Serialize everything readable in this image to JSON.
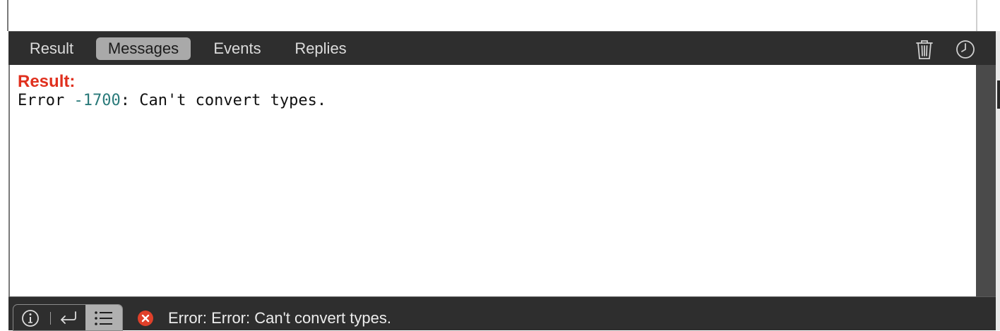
{
  "tabs": {
    "result": "Result",
    "messages": "Messages",
    "events": "Events",
    "replies": "Replies",
    "selected": "Messages"
  },
  "toolbar_icons": [
    "trash-icon",
    "clock-icon"
  ],
  "content": {
    "label": "Result:",
    "error_prefix": "Error ",
    "error_code": "-1700",
    "error_message": ": Can't convert types."
  },
  "status": {
    "buttons": [
      "info-icon",
      "return-icon",
      "list-icon"
    ],
    "selected_button": "list-icon",
    "error_icon": "error-icon",
    "message": "Error: Error: Can't convert types."
  },
  "colors": {
    "result_label": "#e0301e",
    "error_code": "#2a7a7a",
    "error_icon": "#e0402a",
    "bar_background": "#2e2e2e",
    "selected_tab": "#a9a9a9"
  }
}
